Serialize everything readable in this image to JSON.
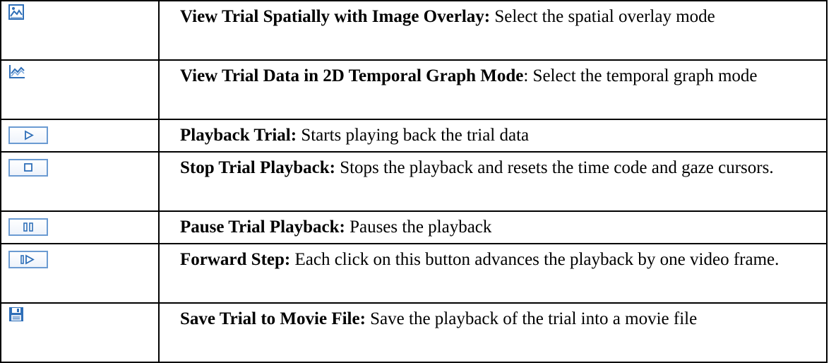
{
  "rows": [
    {
      "icon": "image-overlay-icon",
      "label": "View Trial Spatially with Image Overlay:",
      "desc": " Select the spatial overlay mode"
    },
    {
      "icon": "temporal-graph-icon",
      "label": "View Trial Data in 2D Temporal Graph Mode",
      "desc": ": Select the temporal graph mode"
    },
    {
      "icon": "play-icon",
      "label": "Playback Trial:",
      "desc": " Starts playing back the trial data"
    },
    {
      "icon": "stop-icon",
      "label": "Stop Trial Playback:",
      "desc": " Stops the playback and resets the time code and gaze cursors."
    },
    {
      "icon": "pause-icon",
      "label": "Pause Trial Playback:",
      "desc": " Pauses the playback"
    },
    {
      "icon": "forward-step-icon",
      "label": "Forward Step:",
      "desc": " Each click on this button advances the playback by one video frame."
    },
    {
      "icon": "save-movie-icon",
      "label": "Save Trial to Movie File:",
      "desc": " Save the playback of the trial into a movie file"
    }
  ],
  "colors": {
    "icon_blue": "#2f6fb8",
    "button_border": "#6b9bd2",
    "border": "#000000"
  }
}
